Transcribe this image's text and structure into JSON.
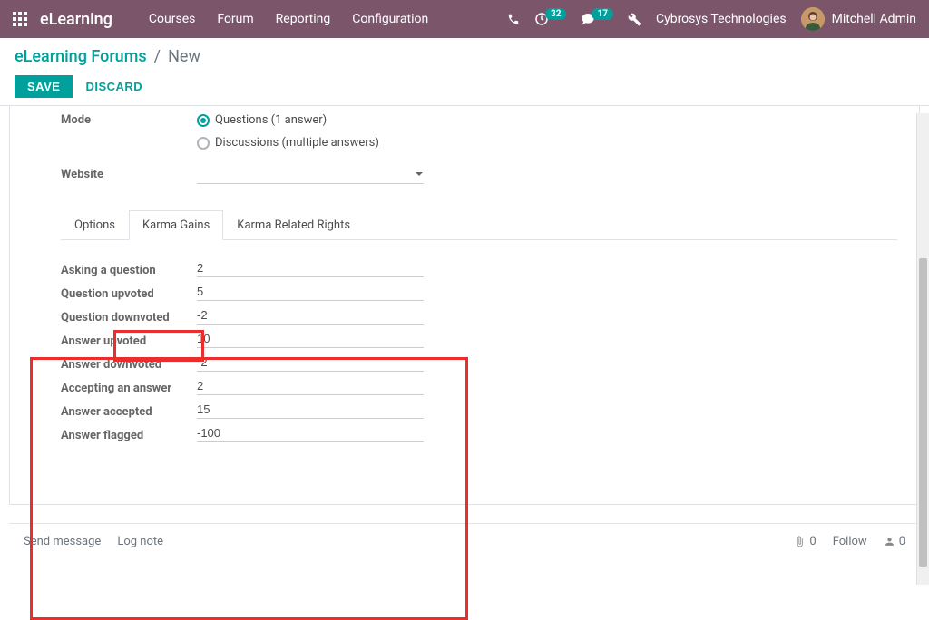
{
  "header": {
    "brand": "eLearning",
    "menu": [
      "Courses",
      "Forum",
      "Reporting",
      "Configuration"
    ],
    "badges": {
      "clock": "32",
      "chat": "17"
    },
    "company": "Cybrosys Technologies",
    "user": "Mitchell Admin"
  },
  "breadcrumb": {
    "root": "eLearning Forums",
    "current": "New"
  },
  "actions": {
    "save": "SAVE",
    "discard": "DISCARD"
  },
  "form": {
    "mode_label": "Mode",
    "mode_options": {
      "questions": "Questions (1 answer)",
      "discussions": "Discussions (multiple answers)"
    },
    "website_label": "Website"
  },
  "tabs": {
    "options": "Options",
    "karma_gains": "Karma Gains",
    "karma_rights": "Karma Related Rights"
  },
  "karma": [
    {
      "label": "Asking a question",
      "value": "2"
    },
    {
      "label": "Question upvoted",
      "value": "5"
    },
    {
      "label": "Question downvoted",
      "value": "-2"
    },
    {
      "label": "Answer upvoted",
      "value": "10"
    },
    {
      "label": "Answer downvoted",
      "value": "-2"
    },
    {
      "label": "Accepting an answer",
      "value": "2"
    },
    {
      "label": "Answer accepted",
      "value": "15"
    },
    {
      "label": "Answer flagged",
      "value": "-100"
    }
  ],
  "chatter": {
    "send": "Send message",
    "log": "Log note",
    "attach": "0",
    "follow": "Follow",
    "followers": "0"
  }
}
